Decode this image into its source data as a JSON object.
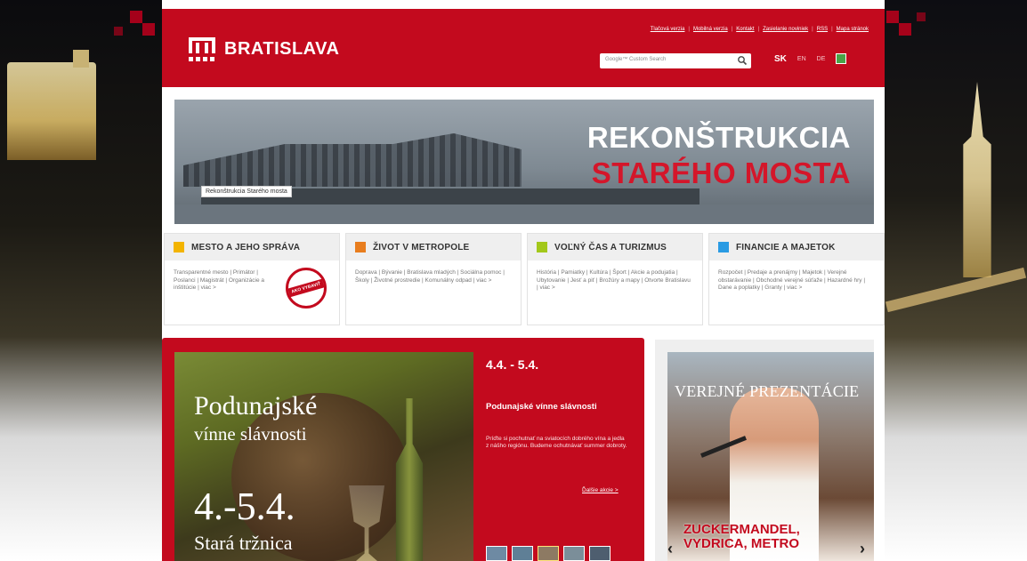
{
  "header": {
    "logo_text": "BRATISLAVA",
    "top_links": [
      "Tlačová verzia",
      "Mobilná verzia",
      "Kontakt",
      "Zasielanie noviniek",
      "RSS",
      "Mapa stránok"
    ],
    "search_placeholder": "Google™ Custom Search",
    "languages": [
      "SK",
      "EN",
      "DE"
    ],
    "active_language": "SK"
  },
  "banner": {
    "title_line1": "REKONŠTRUKCIA",
    "title_line2": "STARÉHO MOSTA",
    "caption": "Rekonštrukcia Starého mosta"
  },
  "categories": [
    {
      "title": "MESTO A JEHO SPRÁVA",
      "color": "#f3b400",
      "body": "Transparentné mesto | Primátor | Poslanci | Magistrát | Organizácie a inštitúcie | viac >",
      "stamp": "AKO VYBAVIŤ"
    },
    {
      "title": "ŽIVOT V METROPOLE",
      "color": "#e87d1e",
      "body": "Doprava | Bývanie | Bratislava mladých | Sociálna pomoc | Školy | Životné prostredie | Komunálny odpad | viac >"
    },
    {
      "title": "VOĽNÝ ČAS A TURIZMUS",
      "color": "#a3c81b",
      "body": "História | Pamiatky | Kultúra | Šport | Akcie a podujatia | Ubytovanie | Jesť a piť | Brožúry a mapy | Otvorte Bratislavu | viac >"
    },
    {
      "title": "FINANCIE A MAJETOK",
      "color": "#2a9be3",
      "body": "Rozpočet | Predaje a prenájmy | Majetok | Verejné obstarávanie | Obchodné verejné súťaže | Hazardné hry | Dane a poplatky | Granty | viac >"
    }
  ],
  "feature": {
    "image_title": "Podunajské",
    "image_subtitle": "vínne slávnosti",
    "image_date": "4.-5.4.",
    "image_place": "Stará tržnica",
    "date": "4.4. - 5.4.",
    "title": "Podunajské vínne slávnosti",
    "body": "Príďte si pochutnať na sviatocích dobrého vína a jedla z nášho regiónu. Budeme ochutnávať summer dobroty.",
    "more": "Ďalšie akcie >"
  },
  "presentation": {
    "title": "VEREJNÉ PREZENTÁCIE",
    "caption_line1": "ZUCKERMANDEL,",
    "caption_line2": "VYDRICA, METRO"
  }
}
